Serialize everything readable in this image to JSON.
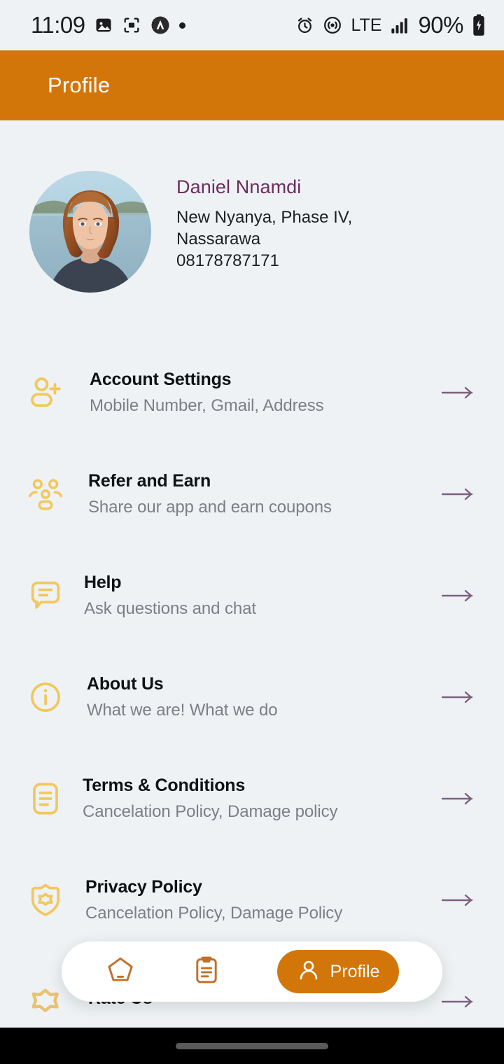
{
  "status_bar": {
    "time": "11:09",
    "battery": "90%",
    "network": "LTE",
    "left_icons": [
      "image-icon",
      "screenshot-icon",
      "app-badge-icon",
      "dot-indicator-icon"
    ],
    "right_icons": [
      "alarm-icon",
      "hotspot-icon",
      "lte-label",
      "signal-bars-icon",
      "battery-icon"
    ]
  },
  "header": {
    "title": "Profile",
    "background_color": "#d2760a",
    "text_color": "#ffffff"
  },
  "profile": {
    "name": "Daniel Nnamdi",
    "name_color": "#6b2d5e",
    "address_line1": "New Nyanya, Phase IV,",
    "address_line2": "Nassarawa",
    "phone": "08178787171",
    "avatar": "user-profile-photo"
  },
  "menu": {
    "icon_color": "#f2c75c",
    "arrow_color": "#7e6080",
    "items": [
      {
        "title": "Account Settings",
        "subtitle": "Mobile Number, Gmail, Address",
        "icon": "add-person-icon"
      },
      {
        "title": "Refer and Earn",
        "subtitle": "Share our app and earn coupons",
        "icon": "people-group-icon"
      },
      {
        "title": "Help",
        "subtitle": "Ask questions and chat",
        "icon": "chat-bubble-icon"
      },
      {
        "title": "About Us",
        "subtitle": "What we are! What we do",
        "icon": "info-circle-icon"
      },
      {
        "title": "Terms & Conditions",
        "subtitle": "Cancelation Policy, Damage policy",
        "icon": "document-lines-icon"
      },
      {
        "title": "Privacy Policy",
        "subtitle": "Cancelation Policy, Damage Policy",
        "icon": "shield-star-icon"
      },
      {
        "title": "Rate Us",
        "subtitle": "",
        "icon": "star-outline-icon"
      }
    ]
  },
  "bottom_nav": {
    "active_color": "#d2760a",
    "items": [
      {
        "label": "",
        "icon": "home-pentagon-icon",
        "active": false
      },
      {
        "label": "",
        "icon": "clipboard-orders-icon",
        "active": false
      },
      {
        "label": "Profile",
        "icon": "person-icon",
        "active": true
      }
    ]
  }
}
